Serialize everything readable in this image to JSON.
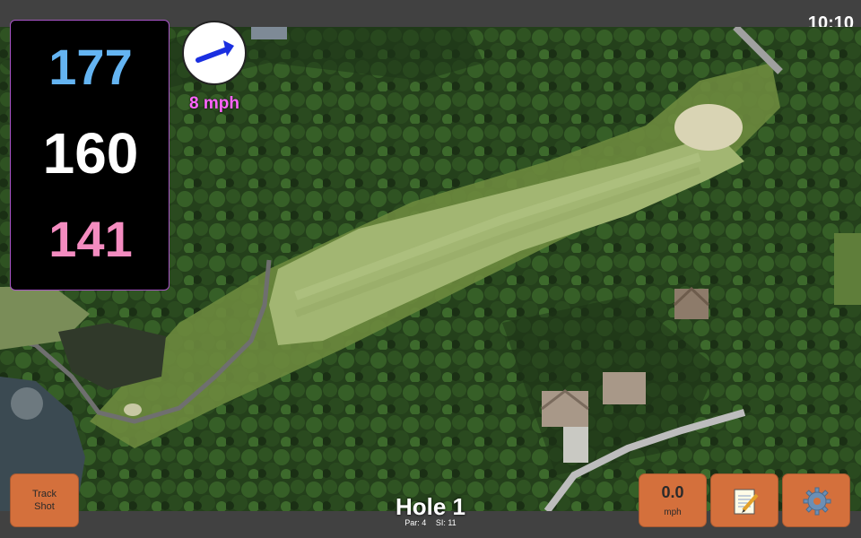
{
  "status": {
    "time": "10:10"
  },
  "distances": {
    "back": "177",
    "middle": "160",
    "front": "141"
  },
  "wind": {
    "speed_label": "8 mph",
    "arrow": "right-arrow-icon"
  },
  "buttons": {
    "track_line1": "Track",
    "track_line2": "Shot",
    "speed_value": "0.0",
    "speed_unit": "mph",
    "notes_icon": "notepad-icon",
    "settings_icon": "gear-icon"
  },
  "hole": {
    "title": "Hole 1",
    "par": "Par: 4",
    "si": "SI: 11"
  },
  "colors": {
    "back_distance": "#64b4f2",
    "middle_distance": "#ffffff",
    "front_distance": "#f48cc0",
    "wind_label": "#ff66ff",
    "button": "#d4703c"
  }
}
